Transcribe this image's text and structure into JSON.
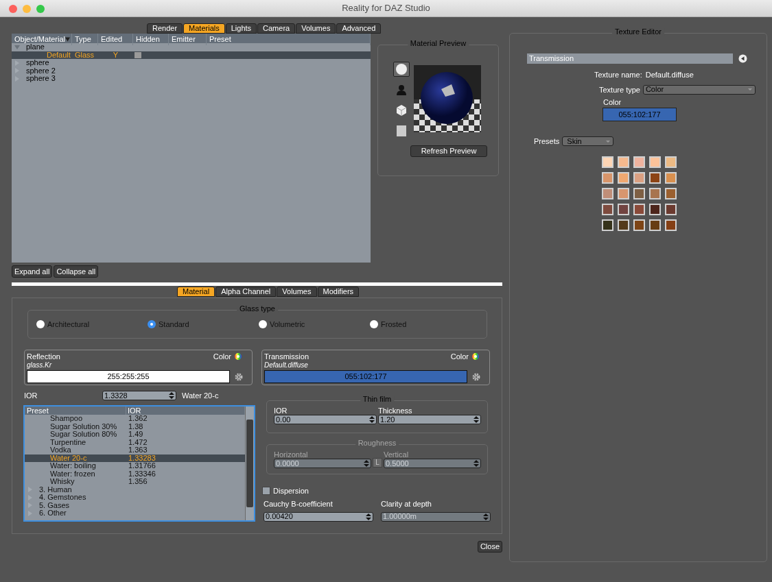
{
  "window": {
    "title": "Reality for DAZ Studio"
  },
  "render_tabs": [
    {
      "label": "Render",
      "selected": false
    },
    {
      "label": "Materials",
      "selected": true
    },
    {
      "label": "Lights",
      "selected": false
    },
    {
      "label": "Camera",
      "selected": false
    },
    {
      "label": "Volumes",
      "selected": false
    },
    {
      "label": "Advanced",
      "selected": false
    }
  ],
  "tree": {
    "columns": [
      "Object/Material",
      "Type",
      "Edited",
      "Hidden",
      "Emitter",
      "Preset"
    ],
    "rows": [
      {
        "name": "plane",
        "expanded": true,
        "children": [
          {
            "name": "Default",
            "type": "Glass",
            "edited": "Y",
            "hidden": false,
            "selected": true
          }
        ]
      },
      {
        "name": "sphere",
        "expanded": false
      },
      {
        "name": "sphere 2",
        "expanded": false
      },
      {
        "name": "sphere 3",
        "expanded": false
      }
    ]
  },
  "tree_buttons": [
    "Expand all",
    "Collapse all"
  ],
  "material_preview": {
    "title": "Material Preview",
    "shapes": [
      {
        "kind": "sphere",
        "selected": true
      },
      {
        "kind": "figure",
        "selected": false
      },
      {
        "kind": "cube",
        "selected": false
      },
      {
        "kind": "plane",
        "selected": false
      }
    ],
    "button": "Refresh Preview"
  },
  "material_tabs": [
    {
      "label": "Material",
      "selected": true
    },
    {
      "label": "Alpha Channel",
      "selected": false
    },
    {
      "label": "Volumes",
      "selected": false
    },
    {
      "label": "Modifiers",
      "selected": false
    }
  ],
  "glass_type": {
    "title": "Glass type",
    "options": [
      {
        "label": "Architectural",
        "selected": false
      },
      {
        "label": "Standard",
        "selected": true
      },
      {
        "label": "Volumetric",
        "selected": false
      },
      {
        "label": "Frosted",
        "selected": false
      }
    ]
  },
  "channels": [
    {
      "label": "Reflection",
      "color_label": "Color",
      "texture": "glass.Kr",
      "value": "255:255:255",
      "color": "#ffffff"
    },
    {
      "label": "Transmission",
      "color_label": "Color",
      "texture": "Default.diffuse",
      "value": "055:102:177",
      "color": "#3766b1"
    }
  ],
  "ior": {
    "label": "IOR",
    "value": "1.3328",
    "preset": "Water 20-c"
  },
  "preset_list": {
    "columns": [
      "Preset",
      "IOR"
    ],
    "rows": [
      {
        "name": "Shampoo",
        "ior": "1.362",
        "selected": false
      },
      {
        "name": "Sugar Solution 30%",
        "ior": "1.38",
        "selected": false
      },
      {
        "name": "Sugar Solution 80%",
        "ior": "1.49",
        "selected": false
      },
      {
        "name": "Turpentine",
        "ior": "1.472",
        "selected": false
      },
      {
        "name": "Vodka",
        "ior": "1.363",
        "selected": false
      },
      {
        "name": "Water 20-c",
        "ior": "1.33283",
        "selected": true
      },
      {
        "name": "Water: boiling",
        "ior": "1.31766",
        "selected": false
      },
      {
        "name": "Water: frozen",
        "ior": "1.33346",
        "selected": false
      },
      {
        "name": "Whisky",
        "ior": "1.356",
        "selected": false
      }
    ],
    "categories": [
      {
        "label": "3. Human",
        "expanded": false
      },
      {
        "label": "4. Gemstones",
        "expanded": false
      },
      {
        "label": "5. Gases",
        "expanded": false
      },
      {
        "label": "6. Other",
        "expanded": false
      }
    ]
  },
  "thin_film": {
    "title": "Thin film",
    "fields": [
      {
        "label": "IOR",
        "value": "0.00"
      },
      {
        "label": "Thickness",
        "value": "1.20"
      }
    ]
  },
  "roughness": {
    "title": "Roughness",
    "disabled": true,
    "fields": [
      {
        "label": "Horizontal",
        "value": "0.0000"
      },
      {
        "label": "Vertical",
        "value": "0.5000"
      }
    ],
    "lock": "L"
  },
  "dispersion": {
    "label": "Dispersion",
    "checked": false
  },
  "dispersion_fields": [
    {
      "label": "Cauchy B-coefficient",
      "value": "0.00420",
      "disabled": false
    },
    {
      "label": "Clarity at depth",
      "value": "1.00000m",
      "disabled": true
    }
  ],
  "close_button": "Close",
  "texture_editor": {
    "title": "Texture Editor",
    "channel": "Transmission",
    "texture_name_label": "Texture name:",
    "texture_name": "Default.diffuse",
    "texture_type_label": "Texture type",
    "texture_type": "Color",
    "color_label": "Color",
    "color_value": "055:102:177",
    "color": "#3766b1",
    "presets_label": "Presets",
    "presets_value": "Skin",
    "swatches": [
      {
        "color": "#fdd5b5"
      },
      {
        "color": "#f5b98e"
      },
      {
        "color": "#efb39f"
      },
      {
        "color": "#fcc39a"
      },
      {
        "color": "#ecba84"
      },
      {
        "color": "#d8956a"
      },
      {
        "color": "#f0a870"
      },
      {
        "color": "#dba082"
      },
      {
        "color": "#8c4415"
      },
      {
        "color": "#d8904f"
      },
      {
        "color": "#bf8e78"
      },
      {
        "color": "#d8966e"
      },
      {
        "color": "#7e5f43"
      },
      {
        "color": "#a8754f"
      },
      {
        "color": "#9b6030"
      },
      {
        "color": "#7e4b3e"
      },
      {
        "color": "#714340"
      },
      {
        "color": "#8a4a39"
      },
      {
        "color": "#4d251b"
      },
      {
        "color": "#6b3a2f"
      },
      {
        "color": "#36331a"
      },
      {
        "color": "#543a1a"
      },
      {
        "color": "#7d4416"
      },
      {
        "color": "#673d12"
      },
      {
        "color": "#843f15"
      }
    ]
  }
}
